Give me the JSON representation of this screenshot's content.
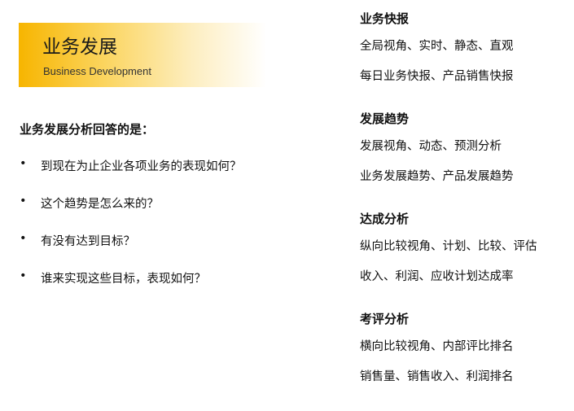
{
  "banner": {
    "title": "业务发展",
    "subtitle": "Business Development",
    "colors": {
      "gradient_start": "#f7b500",
      "gradient_end": "#ffffff"
    }
  },
  "questions": {
    "heading": "业务发展分析回答的是：",
    "bullet": "•",
    "items": [
      "到现在为止企业各项业务的表现如何？",
      "这个趋势是怎么来的？",
      "有没有达到目标？",
      "谁来实现这些目标，表现如何？"
    ]
  },
  "sections": [
    {
      "title": "业务快报",
      "lines": [
        "全局视角、实时、静态、直观",
        "每日业务快报、产品销售快报"
      ]
    },
    {
      "title": "发展趋势",
      "lines": [
        "发展视角、动态、预测分析",
        "业务发展趋势、产品发展趋势"
      ]
    },
    {
      "title": "达成分析",
      "lines": [
        "纵向比较视角、计划、比较、评估",
        "收入、利润、应收计划达成率"
      ]
    },
    {
      "title": "考评分析",
      "lines": [
        "横向比较视角、内部评比排名",
        "销售量、销售收入、利润排名"
      ]
    }
  ]
}
